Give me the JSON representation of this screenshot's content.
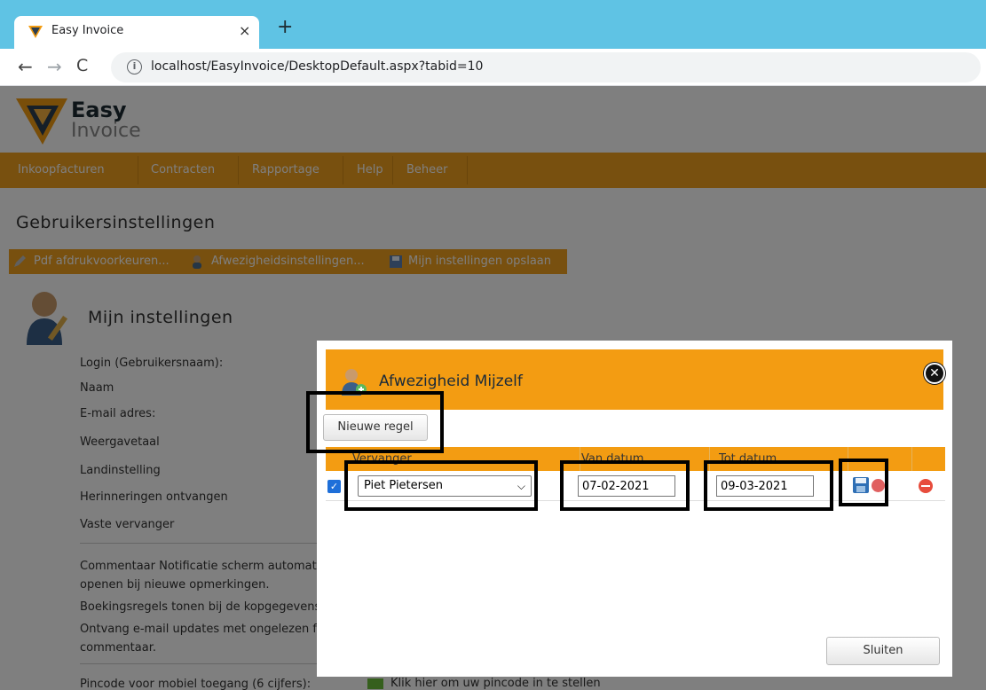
{
  "browser": {
    "tab_title": "Easy Invoice",
    "tab_close": "×",
    "new_tab": "+",
    "back": "←",
    "forward": "→",
    "reload": "C",
    "info": "i",
    "url": "localhost/EasyInvoice/DesktopDefault.aspx?tabid=10"
  },
  "app": {
    "logo_line1": "Easy",
    "logo_line2": "Invoice",
    "menu": [
      "Inkoopfacturen",
      "Contracten",
      "Rapportage",
      "Help",
      "Beheer"
    ],
    "page_title": "Gebruikersinstellingen",
    "toolbar": [
      "Pdf afdrukvoorkeuren...",
      "Afwezigheidsinstellingen...",
      "Mijn instellingen opslaan"
    ],
    "section_title": "Mijn instellingen",
    "form_labels": [
      "Login (Gebruikersnaam):",
      "Naam",
      "E-mail adres:",
      "Weergavetaal",
      "Landinstelling",
      "Herinneringen ontvangen",
      "Vaste vervanger",
      "Commentaar Notificatie scherm automat",
      "openen bij nieuwe opmerkingen.",
      "Boekingsregels tonen bij de kopgegevens",
      "Ontvang e-mail updates met ongelezen fa",
      "commentaar.",
      "Pincode voor mobiel toegang (6 cijfers):"
    ],
    "pin_link": "Klik hier om uw pincode in te stellen"
  },
  "modal": {
    "title": "Afwezigheid Mijzelf",
    "close_glyph": "✕",
    "new_row_button": "Nieuwe regel",
    "columns": [
      "Vervanger",
      "Van datum",
      "Tot datum"
    ],
    "row": {
      "checked": true,
      "check_glyph": "✓",
      "substitute": "Piet Pietersen",
      "from_date": "07-02-2021",
      "to_date": "09-03-2021"
    },
    "close_button": "Sluiten"
  },
  "colors": {
    "accent": "#f39c12",
    "browser_bar": "#5fc3e4"
  }
}
